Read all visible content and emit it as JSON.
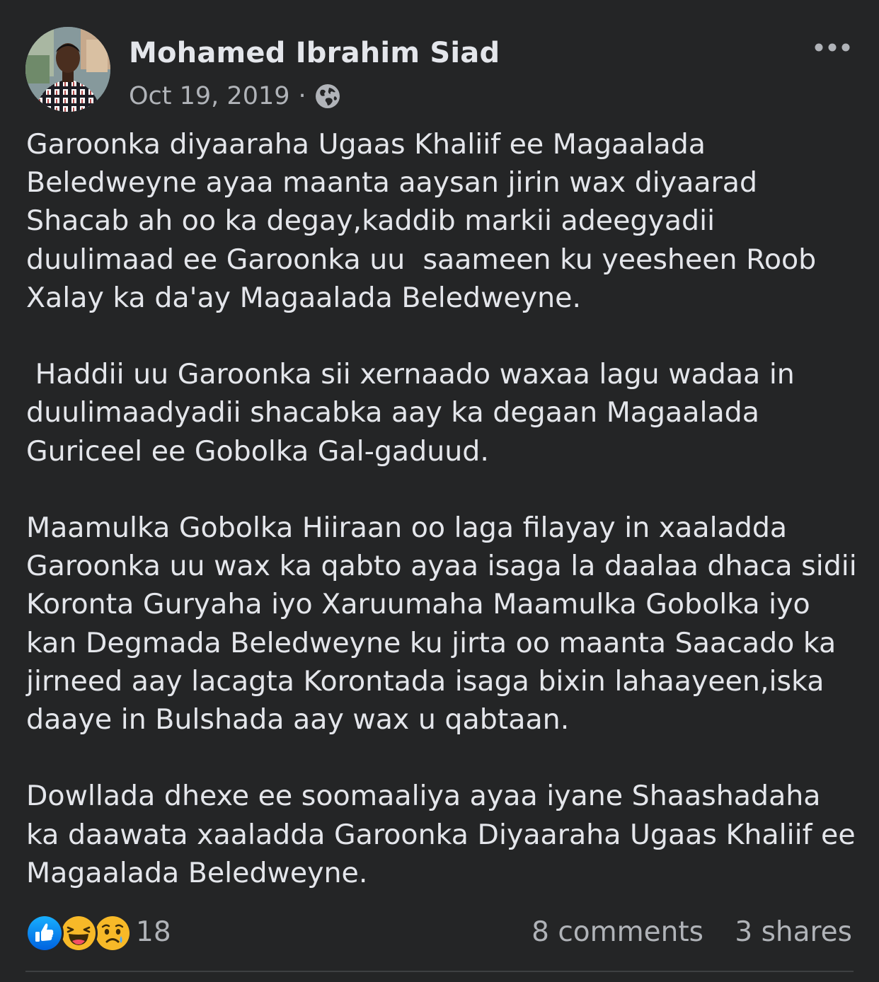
{
  "post": {
    "author": "Mohamed Ibrahim Siad",
    "date": "Oct 19, 2019",
    "separator": "·",
    "privacy_icon": "globe-icon",
    "more_icon": "more-options-icon",
    "paragraphs": [
      "Garoonka diyaaraha Ugaas Khaliif ee Magaalada Beledweyne ayaa maanta aaysan jirin wax diyaarad Shacab ah oo ka degay,kaddib markii adeegyadii duulimaad ee Garoonka uu  saameen ku yeesheen Roob Xalay ka da'ay Magaalada Beledweyne.",
      " Haddii uu Garoonka sii xernaado waxaa lagu wadaa in duulimaadyadii shacabka aay ka degaan Magaalada Guriceel ee Gobolka Gal-gaduud.",
      "Maamulka Gobolka Hiiraan oo laga filayay in xaaladda Garoonka uu wax ka qabto ayaa isaga la daalaa dhaca sidii Koronta Guryaha iyo Xaruumaha Maamulka Gobolka iyo kan Degmada Beledweyne ku jirta oo maanta Saacado ka jirneed aay lacagta Korontada isaga bixin lahaayeen,iska daaye in Bulshada aay wax u qabtaan.",
      "Dowllada dhexe ee soomaaliya ayaa iyane Shaashadaha ka daawata xaaladda Garoonka Diyaaraha Ugaas Khaliif ee Magaalada Beledweyne."
    ]
  },
  "reactions": {
    "icons": [
      "like-reaction-icon",
      "haha-reaction-icon",
      "sad-reaction-icon"
    ],
    "count": "18"
  },
  "engagement": {
    "comments": "8 comments",
    "shares": "3 shares"
  },
  "colors": {
    "background": "#242526",
    "primary_text": "#e4e6eb",
    "secondary_text": "#b0b3b8",
    "like_blue": "#1877f2",
    "emoji_yellow": "#f7b928"
  }
}
